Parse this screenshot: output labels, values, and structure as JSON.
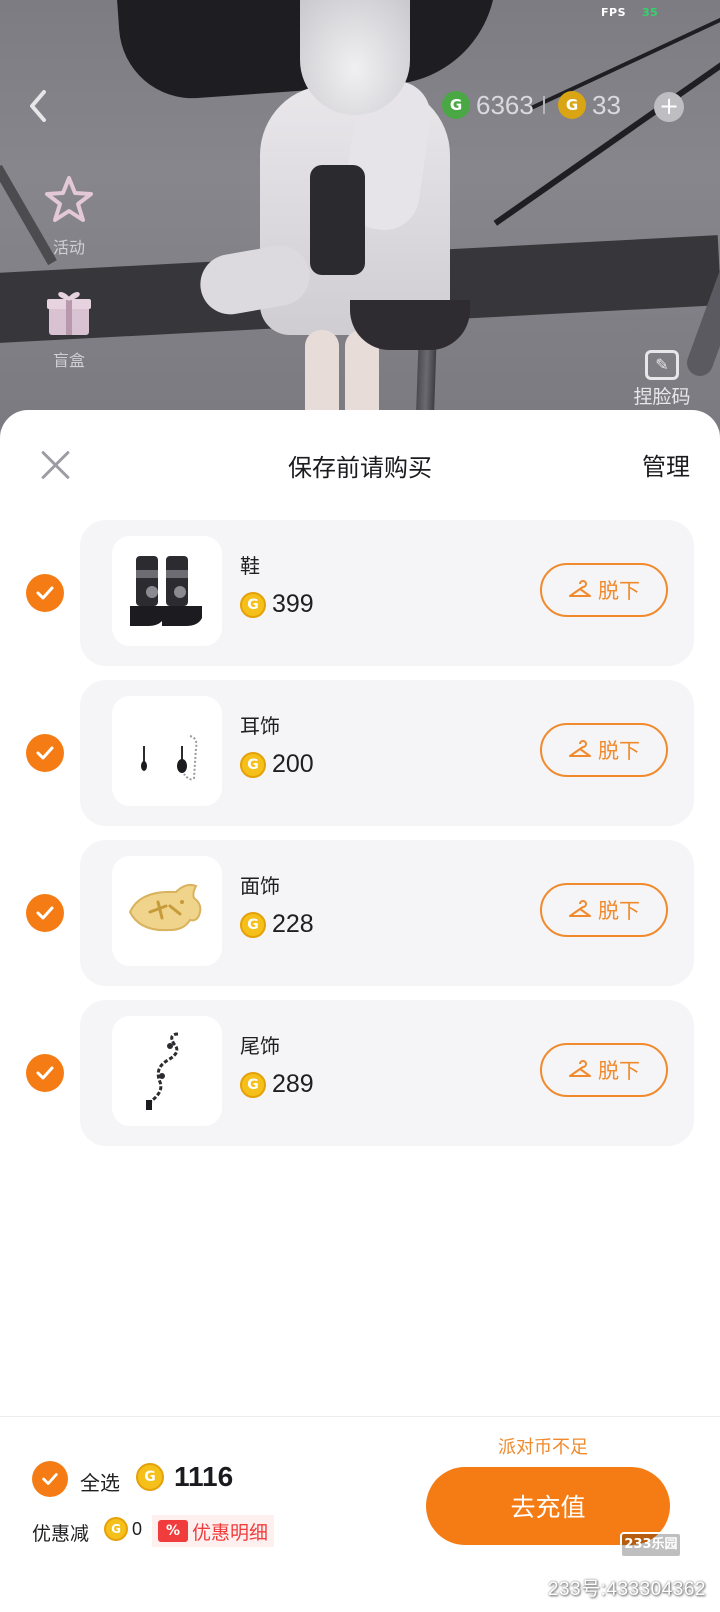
{
  "hud": {
    "fps_label": "FPS",
    "fps_value": "35",
    "g_coin_amount": "6363",
    "gold_coin_amount": "33"
  },
  "side_menu": [
    {
      "label": "活动",
      "icon": "star-icon"
    },
    {
      "label": "盲盒",
      "icon": "gift-box-icon"
    }
  ],
  "face_code_label": "捏脸码",
  "sheet": {
    "title": "保存前请购买",
    "manage_label": "管理",
    "takeoff_label": "脱下",
    "items": [
      {
        "name": "鞋",
        "price": "399",
        "icon": "boots-icon",
        "checked": true
      },
      {
        "name": "耳饰",
        "price": "200",
        "icon": "earrings-icon",
        "checked": true
      },
      {
        "name": "面饰",
        "price": "228",
        "icon": "taiyaki-face-icon",
        "checked": true
      },
      {
        "name": "尾饰",
        "price": "289",
        "icon": "chain-tail-icon",
        "checked": true
      }
    ]
  },
  "footer": {
    "select_all_label": "全选",
    "total": "1116",
    "discount_label": "优惠减",
    "discount_value": "0",
    "detail_label": "优惠明细",
    "detail_badge": "%",
    "insufficient_label": "派对币不足",
    "recharge_label": "去充值"
  },
  "watermark": {
    "logo": "233乐园",
    "id_text": "233号:433304362"
  },
  "colors": {
    "accent": "#f57c14",
    "button_outline": "#f08a2c",
    "discount_red": "#f03c3c",
    "card_bg": "#f5f5f7"
  }
}
